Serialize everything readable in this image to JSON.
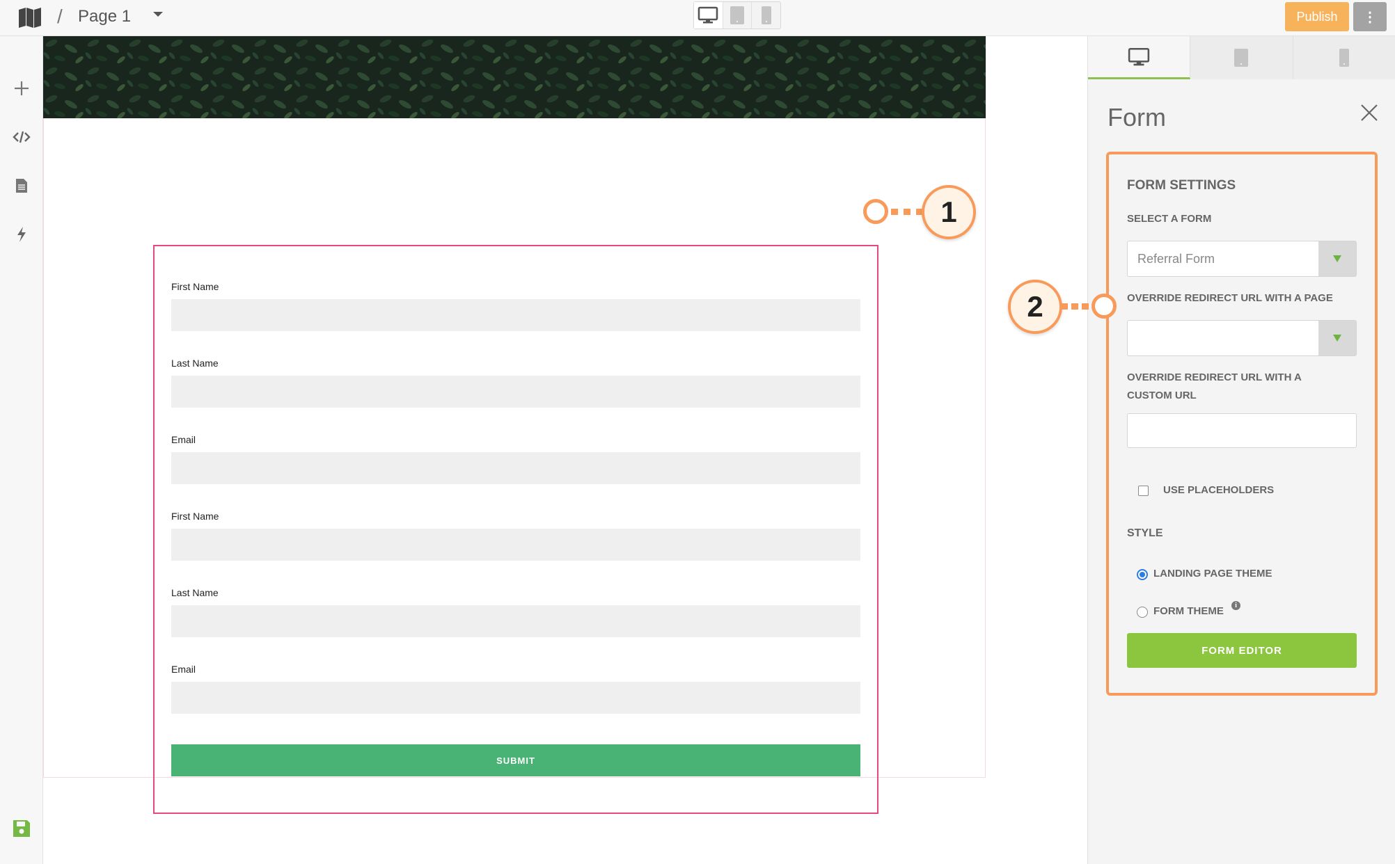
{
  "header": {
    "breadcrumb_separator": "/",
    "page_name": "Page 1",
    "publish_label": "Publish",
    "more_label": "⋮"
  },
  "form": {
    "fields": [
      {
        "label": "First Name",
        "value": ""
      },
      {
        "label": "Last Name",
        "value": ""
      },
      {
        "label": "Email",
        "value": ""
      },
      {
        "label": "First Name",
        "value": ""
      },
      {
        "label": "Last Name",
        "value": ""
      },
      {
        "label": "Email",
        "value": ""
      }
    ],
    "submit_label": "SUBMIT"
  },
  "callouts": [
    "1",
    "2"
  ],
  "panel": {
    "title": "Form",
    "heading": "FORM SETTINGS",
    "select_form_label": "SELECT A FORM",
    "select_form_value": "Referral Form",
    "override_page_label": "OVERRIDE REDIRECT URL WITH A PAGE",
    "override_page_value": "",
    "override_custom_label_1": "OVERRIDE REDIRECT URL WITH A",
    "override_custom_label_2": "CUSTOM URL",
    "override_custom_value": "",
    "use_placeholders_label": "USE PLACEHOLDERS",
    "use_placeholders_checked": false,
    "style_label": "STYLE",
    "style_options": [
      {
        "label": "LANDING PAGE THEME",
        "checked": true
      },
      {
        "label": "FORM THEME",
        "checked": false
      }
    ],
    "form_editor_label": "FORM EDITOR"
  },
  "colors": {
    "accent_orange": "#f89a5a",
    "publish": "#f7b35b",
    "submit_green": "#48b374",
    "editor_green": "#8cc63f",
    "form_border": "#e6487f"
  }
}
